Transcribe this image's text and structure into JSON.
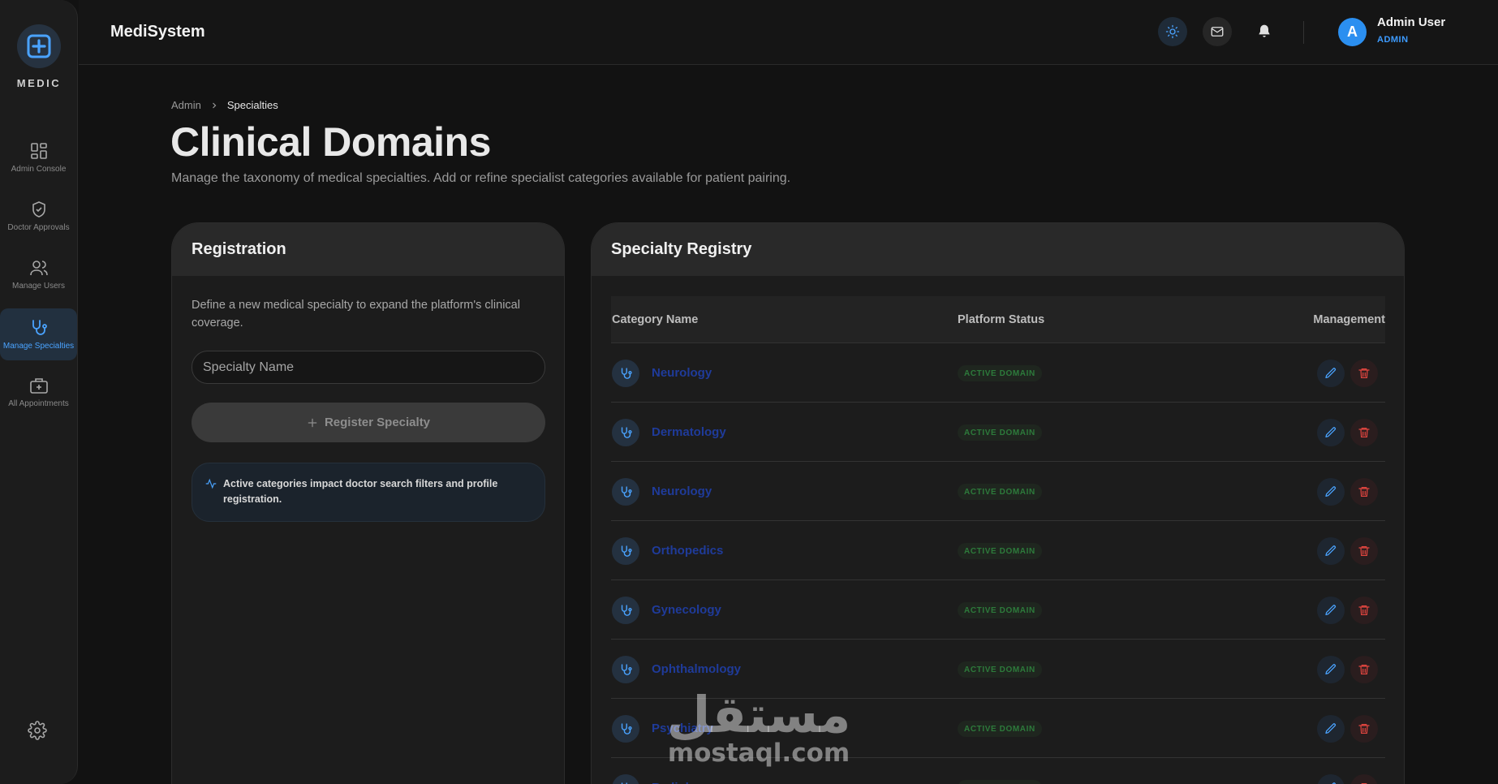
{
  "sidebar": {
    "logo_text": "MEDIC",
    "items": [
      {
        "label": "Admin Console",
        "icon": "grid-icon"
      },
      {
        "label": "Doctor Approvals",
        "icon": "shield-check-icon"
      },
      {
        "label": "Manage Users",
        "icon": "users-icon"
      },
      {
        "label": "Manage Specialties",
        "icon": "stethoscope-icon",
        "active": true
      },
      {
        "label": "All Appointments",
        "icon": "briefcase-medical-icon"
      }
    ],
    "settings_icon": "gear-icon"
  },
  "header": {
    "app_title": "MediSystem",
    "user": {
      "initial": "A",
      "name": "Admin User",
      "role": "ADMIN"
    }
  },
  "breadcrumb": {
    "parent": "Admin",
    "current": "Specialties"
  },
  "page": {
    "title": "Clinical Domains",
    "subtitle": "Manage the taxonomy of medical specialties. Add or refine specialist categories available for patient pairing."
  },
  "registration": {
    "title": "Registration",
    "description": "Define a new medical specialty to expand the platform's clinical coverage.",
    "input_placeholder": "Specialty Name",
    "button_label": "Register Specialty",
    "note": "Active categories impact doctor search filters and profile registration."
  },
  "registry": {
    "title": "Specialty Registry",
    "columns": [
      "Category Name",
      "Platform Status",
      "Management"
    ],
    "rows": [
      {
        "name": "Neurology",
        "status": "ACTIVE DOMAIN"
      },
      {
        "name": "Dermatology",
        "status": "ACTIVE DOMAIN"
      },
      {
        "name": "Neurology",
        "status": "ACTIVE DOMAIN"
      },
      {
        "name": "Orthopedics",
        "status": "ACTIVE DOMAIN"
      },
      {
        "name": "Gynecology",
        "status": "ACTIVE DOMAIN"
      },
      {
        "name": "Ophthalmology",
        "status": "ACTIVE DOMAIN"
      },
      {
        "name": "Psychiatry",
        "status": "ACTIVE DOMAIN"
      },
      {
        "name": "Radiology",
        "status": "ACTIVE DOMAIN"
      }
    ]
  },
  "watermark": {
    "arabic": "مستقل",
    "latin": "mostaql.com"
  },
  "colors": {
    "accent": "#3d9bff",
    "delete": "#e0453f",
    "status": "#2d7a3b",
    "link": "#1f3b9a"
  }
}
